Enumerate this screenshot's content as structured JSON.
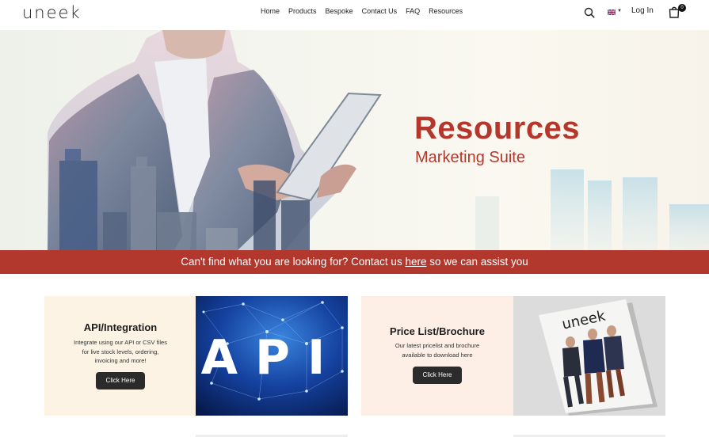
{
  "header": {
    "logo": "uneek",
    "nav": [
      "Home",
      "Products",
      "Bespoke",
      "Contact Us",
      "FAQ",
      "Resources"
    ],
    "login_label": "Log In",
    "cart_count": "0"
  },
  "hero": {
    "title": "Resources",
    "subtitle": "Marketing Suite"
  },
  "banner": {
    "text_before": "Can't find what you are looking for? Contact us ",
    "link_text": "here",
    "text_after": " so we can assist you"
  },
  "cards": [
    {
      "title": "API/Integration",
      "description": "Integrate using our API or CSV files for live stock levels, ordering, invoicing and more!",
      "button": "Click Here",
      "image_text": "API"
    },
    {
      "title": "Price List/Brochure",
      "description": "Our latest pricelist and brochure available to download here",
      "button": "Click Here",
      "image_text": "uneek"
    }
  ],
  "colors": {
    "brand_red": "#b5372c",
    "banner_red": "#b2382e",
    "button_dark": "#2b2b2b",
    "card1_bg": "#fdf3e4",
    "card2_bg": "#fdeee6"
  }
}
